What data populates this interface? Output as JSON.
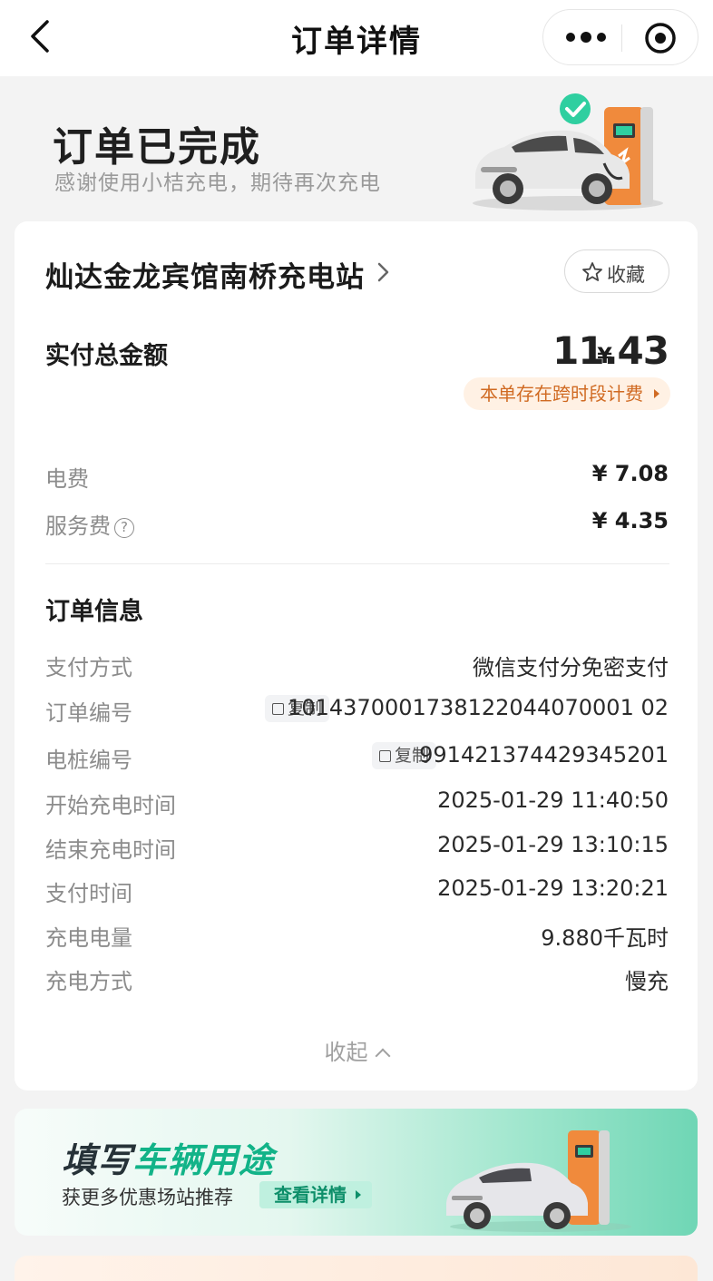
{
  "nav": {
    "title": "订单详情"
  },
  "header": {
    "status_title": "订单已完成",
    "status_subtitle": "感谢使用小桔充电，期待再次充电"
  },
  "station": {
    "name": "灿达金龙宾馆南桥充电站",
    "favorite_label": "收藏"
  },
  "payment": {
    "total_label": "实付总金额",
    "currency": "¥",
    "total_value": "11.43",
    "tag_text": "本单存在跨时段计费",
    "fees": [
      {
        "label": "电费",
        "value": "¥ 7.08"
      },
      {
        "label": "服务费",
        "value": "¥ 4.35",
        "help_glyph": "?"
      }
    ]
  },
  "order_info": {
    "section_title": "订单信息",
    "copy_label": "复制",
    "rows": [
      {
        "label": "支付方式",
        "value": "微信支付分免密支付"
      },
      {
        "label": "订单编号",
        "value": "1014370001738122044070001 02"
      },
      {
        "label": "电桩编号",
        "value": "991421374429345201"
      },
      {
        "label": "开始充电时间",
        "value": "2025-01-29 11:40:50"
      },
      {
        "label": "结束充电时间",
        "value": "2025-01-29 13:10:15"
      },
      {
        "label": "支付时间",
        "value": "2025-01-29 13:20:21"
      },
      {
        "label": "充电电量",
        "value": "9.880千瓦时"
      },
      {
        "label": "充电方式",
        "value": "慢充"
      }
    ],
    "collapse_label": "收起"
  },
  "banner": {
    "title_part1": "填写",
    "title_part2": "车辆用途",
    "subtitle": "获更多优惠场站推荐",
    "button_label": "查看详情"
  },
  "colors": {
    "accent_orange": "#d06a22",
    "accent_green": "#12b388",
    "check_green": "#2fcfa0"
  }
}
